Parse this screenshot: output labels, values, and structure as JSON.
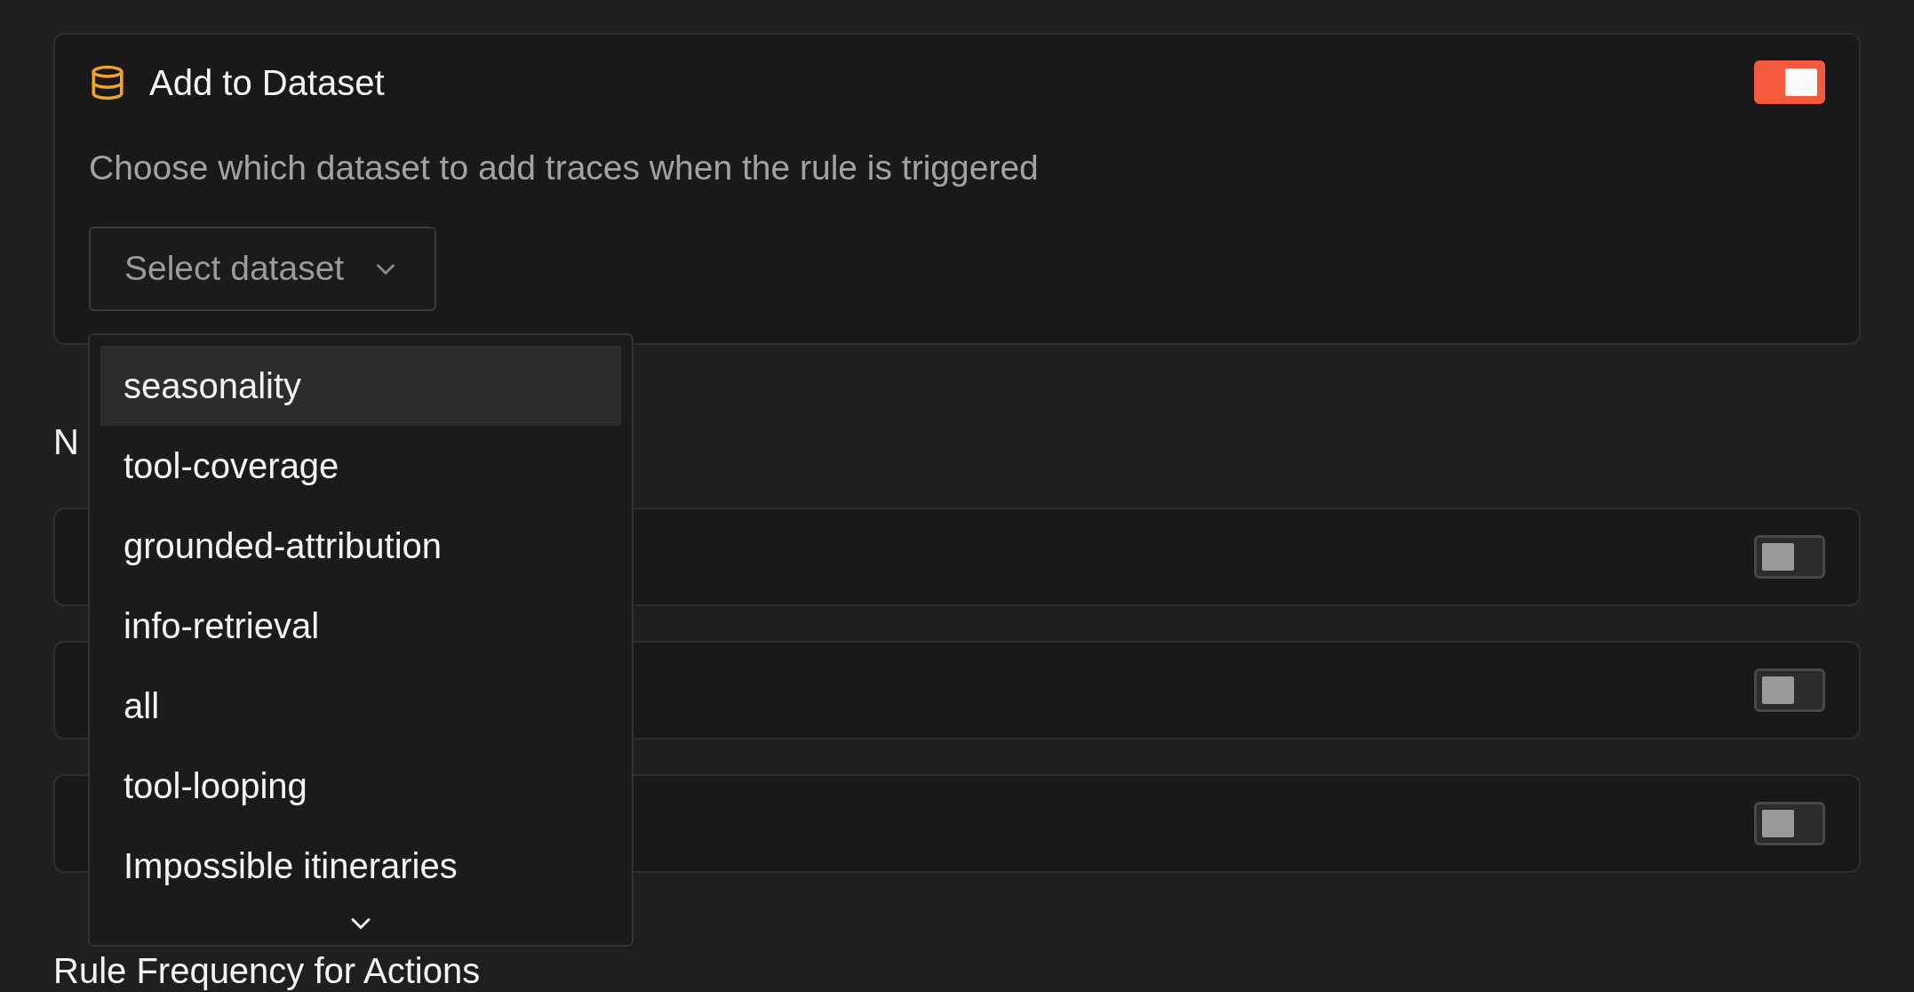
{
  "action_card": {
    "title": "Add to Dataset",
    "enabled": true,
    "description": "Choose which dataset to add traces when the rule is triggered",
    "select": {
      "placeholder": "Select dataset"
    }
  },
  "dropdown": {
    "options": [
      {
        "label": "seasonality",
        "selected": true
      },
      {
        "label": "tool-coverage",
        "selected": false
      },
      {
        "label": "grounded-attribution",
        "selected": false
      },
      {
        "label": "info-retrieval",
        "selected": false
      },
      {
        "label": "all",
        "selected": false
      },
      {
        "label": "tool-looping",
        "selected": false
      },
      {
        "label": "Impossible itineraries",
        "selected": false
      }
    ]
  },
  "section_heading": "N",
  "toggle_rows": [
    {
      "on": false
    },
    {
      "on": false
    },
    {
      "on": false
    }
  ],
  "next_heading": "Rule Frequency for Actions"
}
